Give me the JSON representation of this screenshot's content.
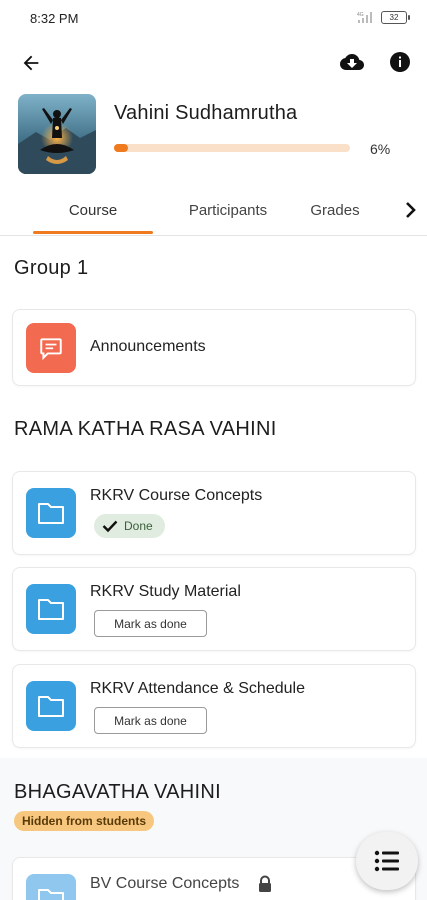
{
  "status_bar": {
    "time": "8:32 PM",
    "battery": "32"
  },
  "app_bar": {
    "back_icon": "arrow-left-icon",
    "download_icon": "cloud-download-icon",
    "info_icon": "info-icon"
  },
  "course": {
    "title": "Vahini Sudhamrutha",
    "progress_percent": 6,
    "progress_label": "6%"
  },
  "tabs": [
    {
      "label": "Course",
      "active": true
    },
    {
      "label": "Participants",
      "active": false
    },
    {
      "label": "Grades",
      "active": false
    }
  ],
  "sections": {
    "group1": {
      "title": "Group 1",
      "items": [
        {
          "label": "Announcements",
          "icon": "forum-icon"
        }
      ]
    },
    "rkrv": {
      "title": "RAMA KATHA RASA VAHINI",
      "items": [
        {
          "label": "RKRV Course Concepts",
          "status": "Done",
          "icon": "folder-icon"
        },
        {
          "label": "RKRV Study Material",
          "action": "Mark as done",
          "icon": "folder-icon"
        },
        {
          "label": "RKRV Attendance & Schedule",
          "action": "Mark as done",
          "icon": "folder-icon"
        }
      ]
    },
    "bv": {
      "title": "BHAGAVATHA VAHINI",
      "badge": "Hidden from students",
      "items": [
        {
          "label": "BV Course Concepts",
          "icon": "folder-icon",
          "locked": true
        }
      ]
    }
  },
  "fab": {
    "icon": "list-icon"
  },
  "colors": {
    "accent": "#f07b1e",
    "announcement_icon_bg": "#f26a4f",
    "folder_icon_bg": "#3aa0e0",
    "done_badge_bg": "#dfecdf",
    "hidden_badge_bg": "#f7c77f"
  }
}
